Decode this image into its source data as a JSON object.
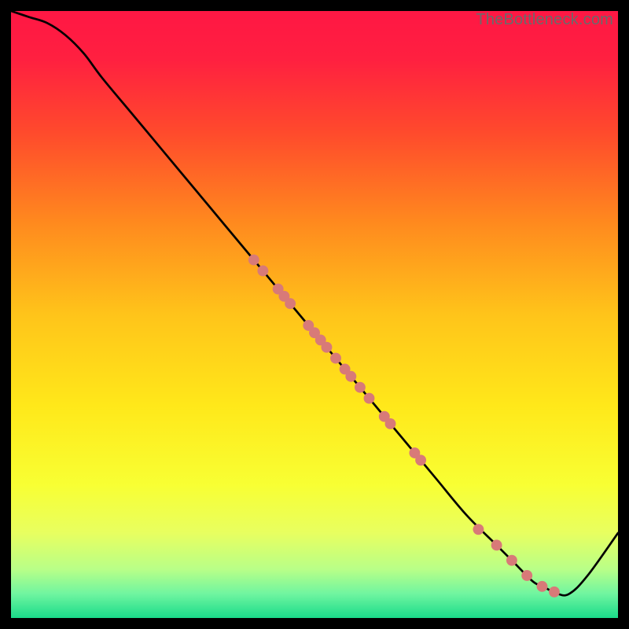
{
  "watermark": "TheBottleneck.com",
  "gradient_stops": [
    {
      "offset": 0.0,
      "color": "#ff1744"
    },
    {
      "offset": 0.08,
      "color": "#ff2040"
    },
    {
      "offset": 0.2,
      "color": "#ff4a2c"
    },
    {
      "offset": 0.35,
      "color": "#ff8a1e"
    },
    {
      "offset": 0.5,
      "color": "#ffc41a"
    },
    {
      "offset": 0.65,
      "color": "#ffe81a"
    },
    {
      "offset": 0.78,
      "color": "#f8ff33"
    },
    {
      "offset": 0.86,
      "color": "#e8ff60"
    },
    {
      "offset": 0.92,
      "color": "#b8ff88"
    },
    {
      "offset": 0.96,
      "color": "#70f5a0"
    },
    {
      "offset": 1.0,
      "color": "#1adb8a"
    }
  ],
  "chart_data": {
    "type": "line",
    "title": "",
    "xlabel": "",
    "ylabel": "",
    "xlim": [
      0,
      100
    ],
    "ylim": [
      0,
      100
    ],
    "series": [
      {
        "name": "curve",
        "x": [
          0,
          3,
          6,
          9,
          12,
          15,
          20,
          25,
          30,
          35,
          40,
          45,
          50,
          55,
          60,
          65,
          70,
          75,
          80,
          83,
          86,
          88,
          90,
          92,
          95,
          100
        ],
        "y": [
          100,
          99,
          98,
          96,
          93,
          89,
          83,
          77,
          71,
          65,
          59,
          53,
          47,
          41,
          35,
          29,
          23,
          17,
          12,
          9,
          6,
          5,
          4,
          4,
          7,
          14
        ]
      }
    ],
    "points": {
      "name": "markers",
      "color": "#d87a78",
      "data": [
        {
          "x": 40.0,
          "y": 59.0
        },
        {
          "x": 41.5,
          "y": 57.2
        },
        {
          "x": 44.0,
          "y": 54.2
        },
        {
          "x": 45.0,
          "y": 53.0
        },
        {
          "x": 46.0,
          "y": 51.8
        },
        {
          "x": 49.0,
          "y": 48.2
        },
        {
          "x": 50.0,
          "y": 47.0
        },
        {
          "x": 51.0,
          "y": 45.8
        },
        {
          "x": 52.0,
          "y": 44.6
        },
        {
          "x": 53.5,
          "y": 42.8
        },
        {
          "x": 55.0,
          "y": 41.0
        },
        {
          "x": 56.0,
          "y": 39.8
        },
        {
          "x": 57.5,
          "y": 38.0
        },
        {
          "x": 59.0,
          "y": 36.2
        },
        {
          "x": 61.5,
          "y": 33.2
        },
        {
          "x": 62.5,
          "y": 32.0
        },
        {
          "x": 66.5,
          "y": 27.2
        },
        {
          "x": 67.5,
          "y": 26.0
        },
        {
          "x": 77.0,
          "y": 14.6
        },
        {
          "x": 80.0,
          "y": 12.0
        },
        {
          "x": 82.5,
          "y": 9.5
        },
        {
          "x": 85.0,
          "y": 7.0
        },
        {
          "x": 87.5,
          "y": 5.2
        },
        {
          "x": 89.5,
          "y": 4.3
        }
      ]
    }
  }
}
